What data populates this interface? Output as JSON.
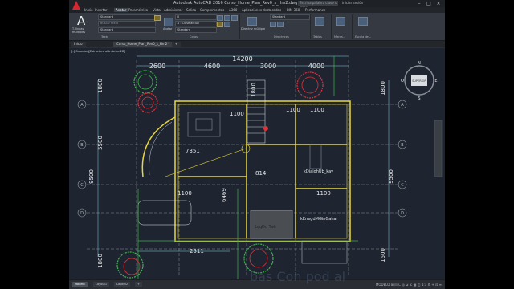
{
  "window": {
    "title": "Autodesk AutoCAD 2016   Curso_Home_Plan_Rev0_s_Hm2.dwg",
    "search_placeholder": "Escriba palabra clave o frase",
    "user_label": "Iniciar sesión"
  },
  "ribbon_tabs": [
    "Inicio",
    "Insertar",
    "Anotar",
    "Paramétrico",
    "Vista",
    "Administrar",
    "Salida",
    "Complementos",
    "A360",
    "Aplicaciones destacadas",
    "BIM 360",
    "Performance"
  ],
  "ribbon": {
    "big_button_glyph": "A",
    "big_button_label": "T. líneas múltiples",
    "text_style": "Standard",
    "text_find": "Buscar texto",
    "text_height": "Standard",
    "layer_current": "0",
    "layer_color": "1 : Clase actual",
    "dim_style": "Standard",
    "mleader_style": "Standard",
    "acotar_label": "Acotar",
    "multileader_label": "Directriz múltiple",
    "panels": [
      "Texto",
      "Cotas",
      "Directrices",
      "Tablas",
      "Marca...",
      "Escala de..."
    ]
  },
  "doc_tabs": [
    "Inicio",
    "Curso_Home_Plan_Rev0_s_Hm2*",
    "+"
  ],
  "viewport_label": "[-][Superior][Estructura alámbrica 2D]",
  "status": {
    "layout_tabs": [
      "Modelo",
      "Layout1",
      "Layout2",
      "+"
    ],
    "right_text": "MODELO  ⊞ ⊟ ∟ ◎ ⊿ ∠ ▦ ◫ 1:1 ⚙ + ⊡ ≡"
  },
  "watermark": "bas Con pod al",
  "drawing": {
    "dims_top": [
      "2600",
      "4600",
      "3000",
      "4000"
    ],
    "dim_top_total": "14200",
    "dims_left": [
      "1800",
      "5500",
      "9500",
      "1800"
    ],
    "dims_right": [
      "1800",
      "9500",
      "1600"
    ],
    "dim_labels": [
      "1100",
      "1100",
      "1100",
      "7351",
      "814",
      "1100",
      "6469",
      "2511",
      "1100"
    ],
    "axis_letters": [
      "A",
      "B",
      "C",
      "D",
      "E"
    ],
    "room_labels": [
      "kDiaighUb_kay",
      "kEnegdMGinGahar",
      "b/qDu Twk"
    ],
    "viewcube_face": "SUPERIOR",
    "compass": [
      "N",
      "S",
      "E",
      "O"
    ]
  },
  "colors": {
    "canvas": "#1f2530",
    "wall_yellow": "#e8d83a",
    "dim_cyan": "#7fd4e8",
    "tree_red": "#e0303a",
    "tree_green": "#3ab54a"
  }
}
